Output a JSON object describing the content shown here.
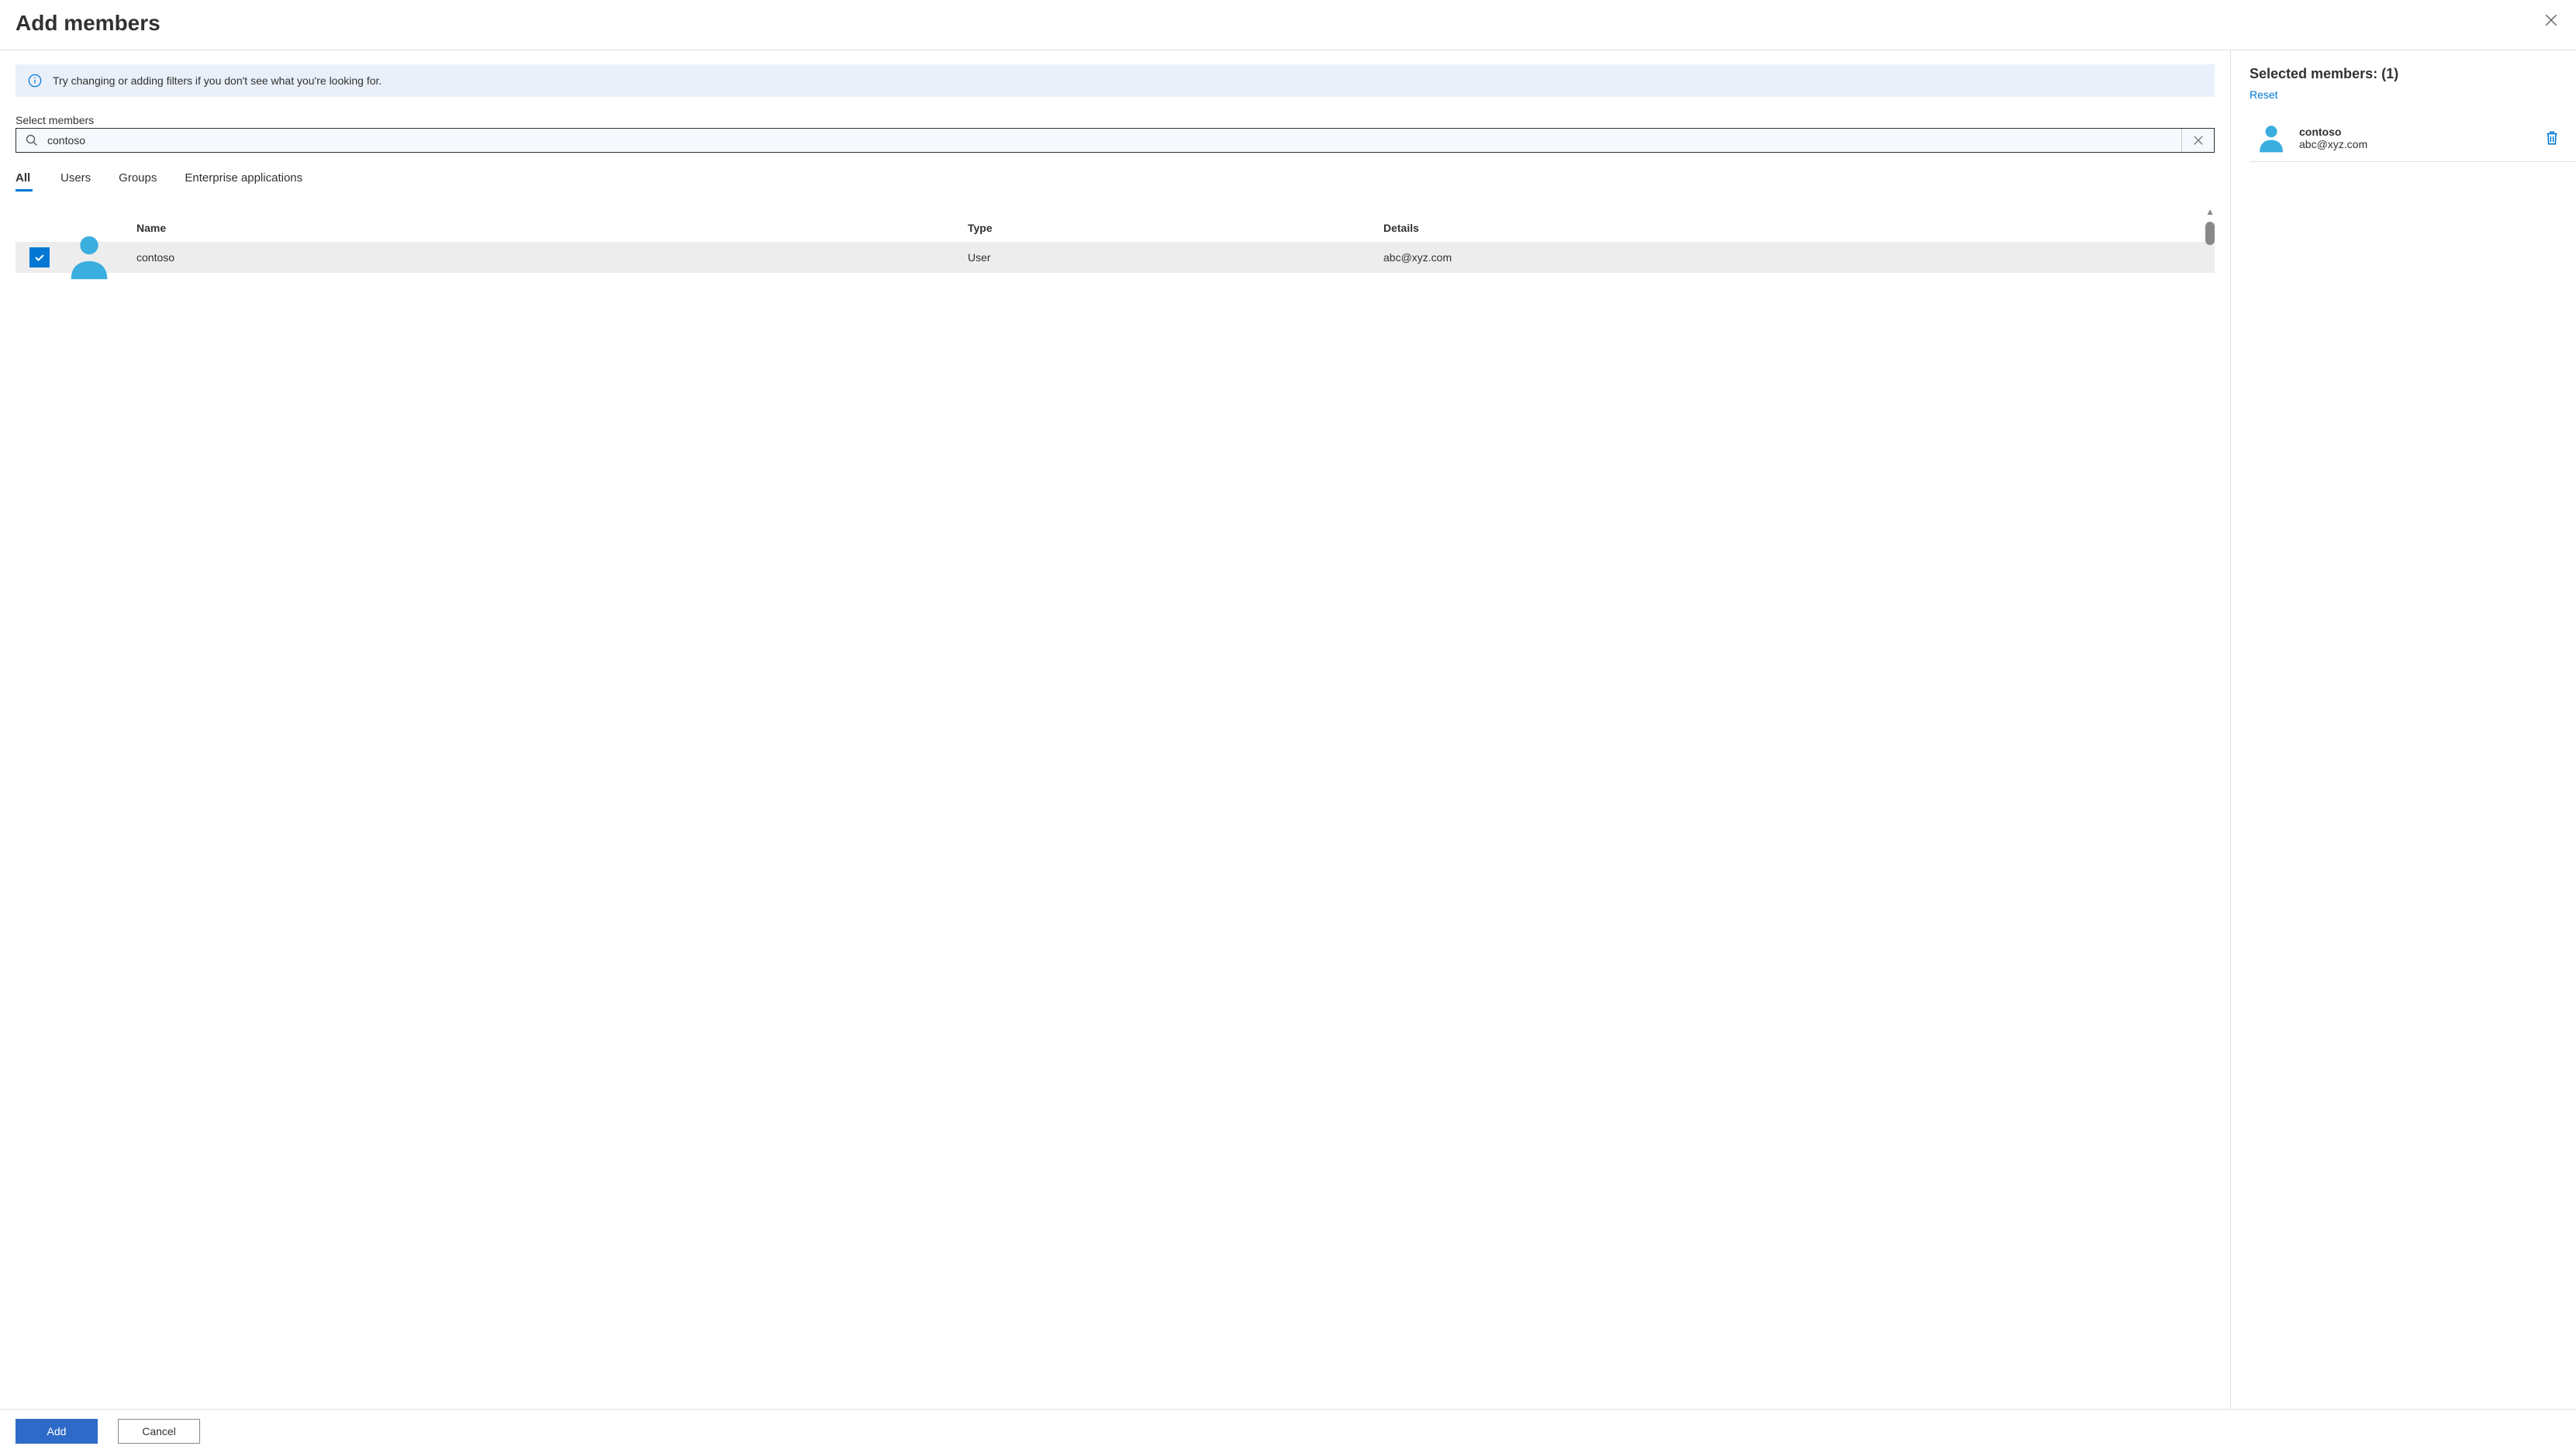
{
  "header": {
    "title": "Add members"
  },
  "info": {
    "message": "Try changing or adding filters if you don't see what you're looking for."
  },
  "search": {
    "label": "Select members",
    "value": "contoso"
  },
  "tabs": [
    {
      "label": "All",
      "active": true
    },
    {
      "label": "Users",
      "active": false
    },
    {
      "label": "Groups",
      "active": false
    },
    {
      "label": "Enterprise applications",
      "active": false
    }
  ],
  "columns": {
    "name": "Name",
    "type": "Type",
    "details": "Details"
  },
  "results": [
    {
      "name": "contoso",
      "type": "User",
      "details": "abc@xyz.com",
      "checked": true
    }
  ],
  "rightPane": {
    "title": "Selected members: (1)",
    "reset": "Reset",
    "selected": [
      {
        "name": "contoso",
        "email": "abc@xyz.com"
      }
    ]
  },
  "footer": {
    "add": "Add",
    "cancel": "Cancel"
  }
}
